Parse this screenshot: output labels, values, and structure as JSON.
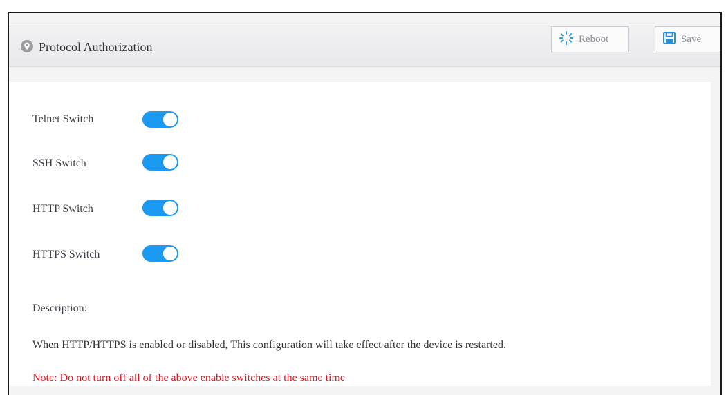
{
  "header": {
    "title": "Protocol Authorization",
    "icon": "location-pin-icon"
  },
  "toolbar": {
    "reboot_label": "Reboot",
    "save_label": "Save"
  },
  "switches": [
    {
      "label": "Telnet Switch",
      "enabled": true
    },
    {
      "label": "SSH Switch",
      "enabled": true
    },
    {
      "label": "HTTP Switch",
      "enabled": true
    },
    {
      "label": "HTTPS Switch",
      "enabled": true
    }
  ],
  "description": {
    "title": "Description:",
    "text": "When HTTP/HTTPS is enabled or disabled, This configuration will take effect after the device is restarted.",
    "note": "Note: Do not turn off all of the above enable switches at the same time"
  },
  "colors": {
    "toggle_on": "#1a9af0",
    "note": "#e8101d"
  }
}
